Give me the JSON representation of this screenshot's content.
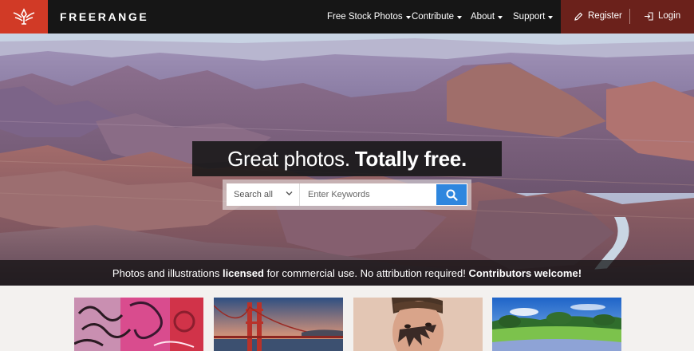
{
  "brand": {
    "name": "FREERANGE",
    "logo_icon": "bird-emblem-icon",
    "accent": "#d13a26"
  },
  "nav": {
    "items": [
      {
        "label": "Free Stock Photos"
      },
      {
        "label": "Contribute"
      },
      {
        "label": "About"
      },
      {
        "label": "Support"
      }
    ],
    "register": {
      "label": "Register",
      "icon": "pencil-icon"
    },
    "login": {
      "label": "Login",
      "icon": "login-icon"
    },
    "auth_bg": "#6b211b"
  },
  "hero": {
    "headline_regular": "Great photos.",
    "headline_bold": "Totally free.",
    "search": {
      "category": "Search all",
      "placeholder": "Enter Keywords",
      "button_color": "#2e86de",
      "button_icon": "search-icon"
    },
    "tagline": {
      "part1": "Photos and illustrations ",
      "bold1": "licensed",
      "part2": " for commercial use. No attribution required! ",
      "bold2": "Contributors welcome!"
    }
  },
  "thumbnails": [
    {
      "subject": "pink-graffiti"
    },
    {
      "subject": "golden-gate-bridge"
    },
    {
      "subject": "face-paint-portrait"
    },
    {
      "subject": "green-meadow"
    }
  ]
}
